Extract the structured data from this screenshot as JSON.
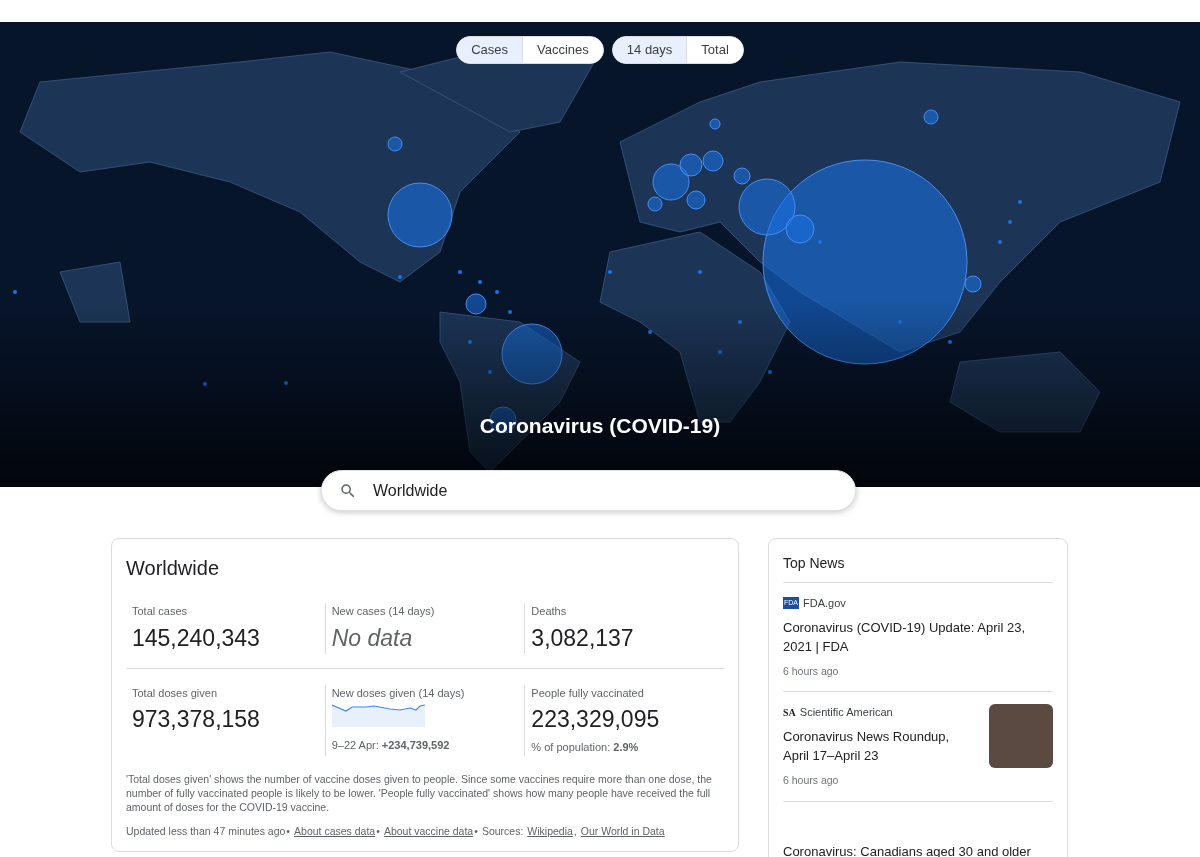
{
  "toggles": [
    {
      "options": [
        {
          "label": "Cases",
          "selected": true
        },
        {
          "label": "Vaccines",
          "selected": false
        }
      ]
    },
    {
      "options": [
        {
          "label": "14 days",
          "selected": true
        },
        {
          "label": "Total",
          "selected": false
        }
      ]
    }
  ],
  "map_title": "Coronavirus (COVID-19)",
  "search": {
    "value": "Worldwide"
  },
  "stats": {
    "title": "Worldwide",
    "rows": [
      [
        {
          "label": "Total cases",
          "value": "145,240,343",
          "kind": "number"
        },
        {
          "label": "New cases (14 days)",
          "value": "No data",
          "kind": "empty"
        },
        {
          "label": "Deaths",
          "value": "3,082,137",
          "kind": "number"
        }
      ],
      [
        {
          "label": "Total doses given",
          "value": "973,378,158",
          "kind": "number"
        },
        {
          "label": "New doses given (14 days)",
          "kind": "sparkline",
          "note": "9–22 Apr: **+234,739,592**"
        },
        {
          "label": "People fully vaccinated",
          "value": "223,329,095",
          "kind": "number",
          "note": "% of population: **2.9%**"
        }
      ]
    ],
    "footnote": "'Total doses given' shows the number of vaccine doses given to people. Since some vaccines require more than one dose, the number of fully vaccinated people is likely to be lower. 'People fully vaccinated' shows how many people have received the full amount of doses for the COVID-19 vaccine.",
    "footer": [
      {
        "text": "Updated less than 47 minutes ago",
        "kind": "text"
      },
      {
        "text": "•",
        "kind": "sep"
      },
      {
        "text": "About cases data",
        "kind": "link"
      },
      {
        "text": "•",
        "kind": "sep"
      },
      {
        "text": "About vaccine data",
        "kind": "link"
      },
      {
        "text": "•",
        "kind": "sep"
      },
      {
        "text": "Sources:",
        "kind": "text"
      },
      {
        "text": "Wikipedia",
        "kind": "link"
      },
      {
        "text": ",",
        "kind": "sep"
      },
      {
        "text": "Our World in Data",
        "kind": "link"
      }
    ]
  },
  "news": {
    "title": "Top News",
    "items": [
      {
        "logo": "FDA",
        "source": "FDA.gov",
        "headline": "Coronavirus (COVID-19) Update: April 23, 2021 | FDA",
        "time": "6 hours ago",
        "has_image": false
      },
      {
        "logo": "SA",
        "source": "Scientific American",
        "headline": "Coronavirus News Roundup, April 17–April 23",
        "time": "6 hours ago",
        "has_image": true
      },
      {
        "headline": "Coronavirus: Canadians aged 30 and older",
        "has_image": false
      }
    ]
  }
}
